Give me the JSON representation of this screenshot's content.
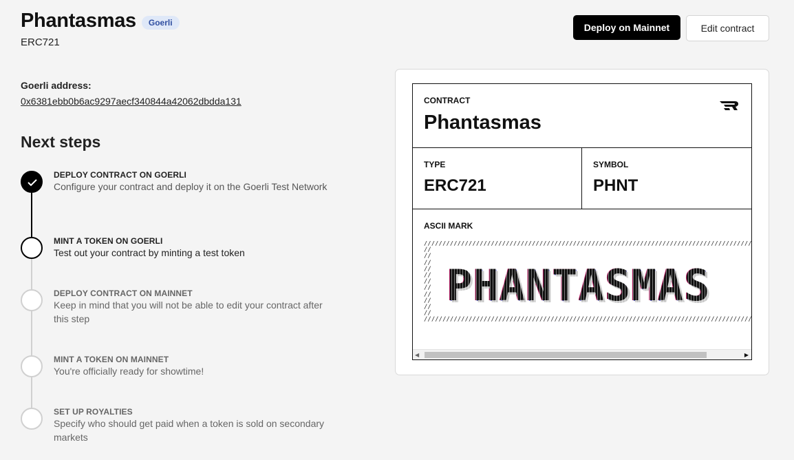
{
  "header": {
    "title": "Phantasmas",
    "network_badge": "Goerli",
    "subtitle": "ERC721",
    "deploy_button": "Deploy on Mainnet",
    "edit_button": "Edit contract"
  },
  "address": {
    "label": "Goerli address:",
    "value": "0x6381ebb0b6ac9297aecf340844a42062dbdda131"
  },
  "next_steps": {
    "heading": "Next steps",
    "steps": [
      {
        "title": "DEPLOY CONTRACT ON GOERLI",
        "description": "Configure your contract and deploy it on the Goerli Test Network",
        "status": "done"
      },
      {
        "title": "MINT A TOKEN ON GOERLI",
        "description": "Test out your contract by minting a test token",
        "status": "current"
      },
      {
        "title": "DEPLOY CONTRACT ON MAINNET",
        "description": "Keep in mind that you will not be able to edit your contract after this step",
        "status": "pending"
      },
      {
        "title": "MINT A TOKEN ON MAINNET",
        "description": "You're officially ready for showtime!",
        "status": "pending"
      },
      {
        "title": "SET UP ROYALTIES",
        "description": "Specify who should get paid when a token is sold on secondary markets",
        "status": "pending"
      }
    ]
  },
  "contract_card": {
    "contract_label": "CONTRACT",
    "contract_name": "Phantasmas",
    "type_label": "TYPE",
    "type_value": "ERC721",
    "symbol_label": "SYMBOL",
    "symbol_value": "PHNT",
    "ascii_label": "ASCII MARK",
    "ascii_word": "PHANTASMAS",
    "logo_icon": "brand-logo-icon"
  }
}
